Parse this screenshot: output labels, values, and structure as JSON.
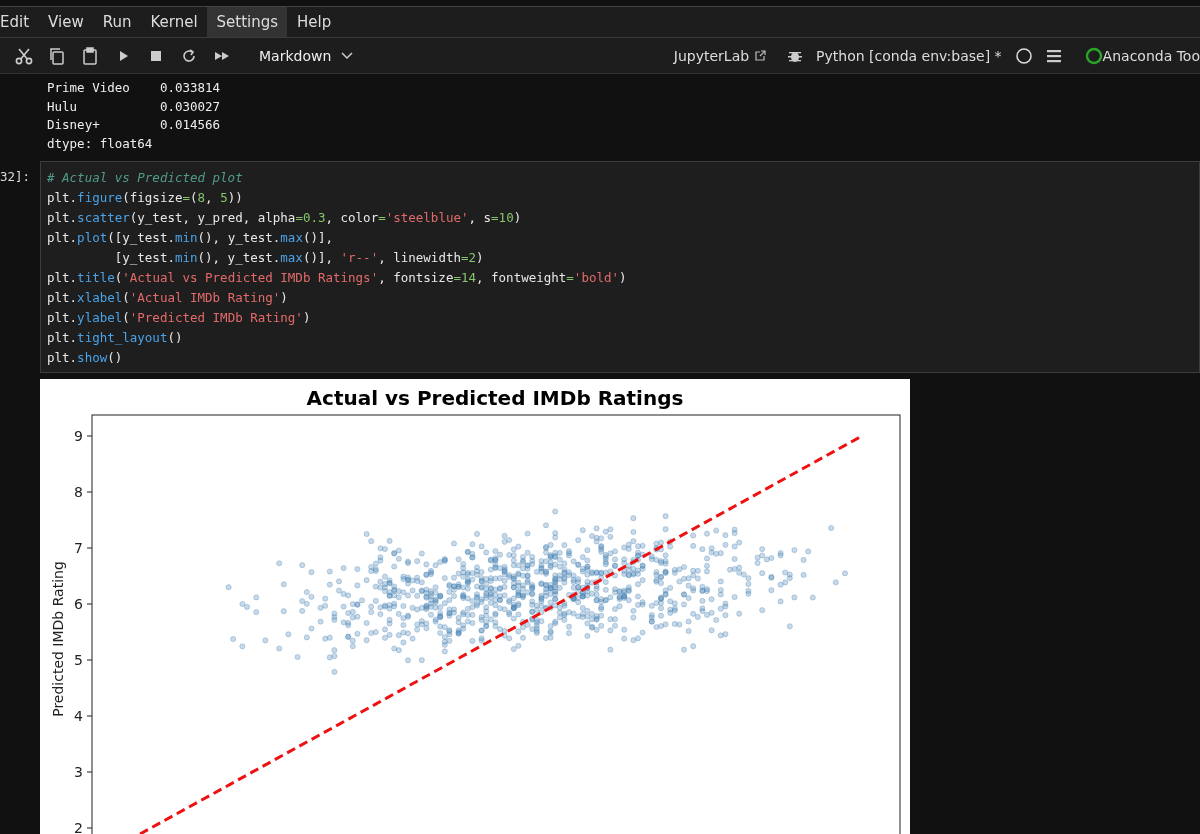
{
  "menu": [
    {
      "label": "Edit",
      "selected": false
    },
    {
      "label": "View",
      "selected": false
    },
    {
      "label": "Run",
      "selected": false
    },
    {
      "label": "Kernel",
      "selected": false
    },
    {
      "label": "Settings",
      "selected": true
    },
    {
      "label": "Help",
      "selected": false
    }
  ],
  "toolbar": {
    "cell_type": "Markdown",
    "jupyterlab_link": "JupyterLab",
    "kernel": "Python [conda env:base] *",
    "anaconda": "Anaconda Too"
  },
  "output": {
    "lines": [
      "Prime Video    0.033814",
      "Hulu           0.030027",
      "Disney+        0.014566",
      "dtype: float64"
    ]
  },
  "cell": {
    "prompt": "32]:",
    "lines": [
      [
        {
          "kind": "comment",
          "text": "# Actual vs Predicted plot"
        }
      ],
      [
        {
          "kind": "plain",
          "text": "plt."
        },
        {
          "kind": "func",
          "text": "figure"
        },
        {
          "kind": "plain",
          "text": "(figsize"
        },
        {
          "kind": "op",
          "text": "="
        },
        {
          "kind": "plain",
          "text": "("
        },
        {
          "kind": "num",
          "text": "8"
        },
        {
          "kind": "plain",
          "text": ", "
        },
        {
          "kind": "num",
          "text": "5"
        },
        {
          "kind": "plain",
          "text": "))"
        }
      ],
      [
        {
          "kind": "plain",
          "text": "plt."
        },
        {
          "kind": "func",
          "text": "scatter"
        },
        {
          "kind": "plain",
          "text": "(y_test, y_pred, alpha"
        },
        {
          "kind": "op",
          "text": "="
        },
        {
          "kind": "num",
          "text": "0.3"
        },
        {
          "kind": "plain",
          "text": ", color"
        },
        {
          "kind": "op",
          "text": "="
        },
        {
          "kind": "str",
          "text": "'steelblue'"
        },
        {
          "kind": "plain",
          "text": ", s"
        },
        {
          "kind": "op",
          "text": "="
        },
        {
          "kind": "num",
          "text": "10"
        },
        {
          "kind": "plain",
          "text": ")"
        }
      ],
      [
        {
          "kind": "plain",
          "text": "plt."
        },
        {
          "kind": "func",
          "text": "plot"
        },
        {
          "kind": "plain",
          "text": "([y_test."
        },
        {
          "kind": "func",
          "text": "min"
        },
        {
          "kind": "plain",
          "text": "(), y_test."
        },
        {
          "kind": "func",
          "text": "max"
        },
        {
          "kind": "plain",
          "text": "()],"
        }
      ],
      [
        {
          "kind": "plain",
          "text": "         [y_test."
        },
        {
          "kind": "func",
          "text": "min"
        },
        {
          "kind": "plain",
          "text": "(), y_test."
        },
        {
          "kind": "func",
          "text": "max"
        },
        {
          "kind": "plain",
          "text": "()], "
        },
        {
          "kind": "str",
          "text": "'r--'"
        },
        {
          "kind": "plain",
          "text": ", linewidth"
        },
        {
          "kind": "op",
          "text": "="
        },
        {
          "kind": "num",
          "text": "2"
        },
        {
          "kind": "plain",
          "text": ")"
        }
      ],
      [
        {
          "kind": "plain",
          "text": "plt."
        },
        {
          "kind": "func",
          "text": "title"
        },
        {
          "kind": "plain",
          "text": "("
        },
        {
          "kind": "str",
          "text": "'Actual vs Predicted IMDb Ratings'"
        },
        {
          "kind": "plain",
          "text": ", fontsize"
        },
        {
          "kind": "op",
          "text": "="
        },
        {
          "kind": "num",
          "text": "14"
        },
        {
          "kind": "plain",
          "text": ", fontweight"
        },
        {
          "kind": "op",
          "text": "="
        },
        {
          "kind": "str",
          "text": "'bold'"
        },
        {
          "kind": "plain",
          "text": ")"
        }
      ],
      [
        {
          "kind": "plain",
          "text": "plt."
        },
        {
          "kind": "func",
          "text": "xlabel"
        },
        {
          "kind": "plain",
          "text": "("
        },
        {
          "kind": "str",
          "text": "'Actual IMDb Rating'"
        },
        {
          "kind": "plain",
          "text": ")"
        }
      ],
      [
        {
          "kind": "plain",
          "text": "plt."
        },
        {
          "kind": "func",
          "text": "ylabel"
        },
        {
          "kind": "plain",
          "text": "("
        },
        {
          "kind": "str",
          "text": "'Predicted IMDb Rating'"
        },
        {
          "kind": "plain",
          "text": ")"
        }
      ],
      [
        {
          "kind": "plain",
          "text": "plt."
        },
        {
          "kind": "func",
          "text": "tight_layout"
        },
        {
          "kind": "plain",
          "text": "()"
        }
      ],
      [
        {
          "kind": "plain",
          "text": "plt."
        },
        {
          "kind": "func",
          "text": "show"
        },
        {
          "kind": "plain",
          "text": "()"
        }
      ]
    ]
  },
  "plot": {
    "title": "Actual vs Predicted IMDb Ratings",
    "ylabel": "Predicted IMDb Rating",
    "ytick_labels": [
      "9",
      "8",
      "7",
      "6",
      "5",
      "4",
      "3",
      "2"
    ]
  }
}
